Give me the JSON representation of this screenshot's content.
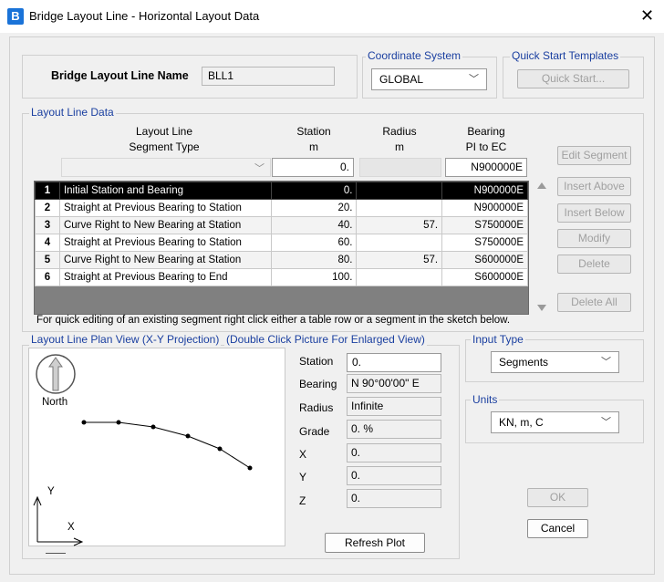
{
  "window": {
    "title": "Bridge Layout Line - Horizontal Layout Data",
    "app_icon": "B"
  },
  "name_section": {
    "label": "Bridge Layout Line Name",
    "value": "BLL1"
  },
  "coordinate_system": {
    "label": "Coordinate System",
    "value": "GLOBAL"
  },
  "quick_start": {
    "label": "Quick Start Templates",
    "button": "Quick Start..."
  },
  "layout_line_data": {
    "label": "Layout Line Data",
    "headers": {
      "segment_type": "Layout Line\nSegment Type",
      "station": "Station\nm",
      "radius": "Radius\nm",
      "bearing": "Bearing\nPI to EC"
    },
    "edit_row": {
      "segment_type": "",
      "station": "0.",
      "radius": "",
      "bearing": "N900000E"
    },
    "rows": [
      {
        "num": "1",
        "segment_type": "Initial Station and Bearing",
        "station": "0.",
        "radius": "",
        "bearing": "N900000E"
      },
      {
        "num": "2",
        "segment_type": "Straight at Previous Bearing to Station",
        "station": "20.",
        "radius": "",
        "bearing": "N900000E"
      },
      {
        "num": "3",
        "segment_type": "Curve Right to New Bearing at Station",
        "station": "40.",
        "radius": "57.",
        "bearing": "S750000E"
      },
      {
        "num": "4",
        "segment_type": "Straight at Previous Bearing to Station",
        "station": "60.",
        "radius": "",
        "bearing": "S750000E"
      },
      {
        "num": "5",
        "segment_type": "Curve Right to New Bearing at Station",
        "station": "80.",
        "radius": "57.",
        "bearing": "S600000E"
      },
      {
        "num": "6",
        "segment_type": "Straight at Previous Bearing to End",
        "station": "100.",
        "radius": "",
        "bearing": "S600000E"
      }
    ],
    "buttons": {
      "edit_segment": "Edit Segment",
      "insert_above": "Insert Above",
      "insert_below": "Insert Below",
      "modify": "Modify",
      "delete": "Delete",
      "delete_all": "Delete All"
    },
    "hint": "For quick editing of an existing segment right click either a table row or a segment in the sketch below."
  },
  "plan_view": {
    "label": "Layout Line Plan View (X-Y Projection)",
    "sublabel": "(Double Click Picture For Enlarged View)",
    "north_label": "North",
    "axis_y": "Y",
    "axis_x": "X"
  },
  "readouts": {
    "station": {
      "label": "Station",
      "value": "0."
    },
    "bearing": {
      "label": "Bearing",
      "value": "N 90°00'00\" E"
    },
    "radius": {
      "label": "Radius",
      "value": "Infinite"
    },
    "grade": {
      "label": "Grade",
      "value": "0. %"
    },
    "x": {
      "label": "X",
      "value": "0."
    },
    "y": {
      "label": "Y",
      "value": "0."
    },
    "z": {
      "label": "Z",
      "value": "0."
    }
  },
  "input_type": {
    "label": "Input Type",
    "value": "Segments"
  },
  "units": {
    "label": "Units",
    "value": "KN, m, C"
  },
  "buttons": {
    "refresh": "Refresh Plot",
    "ok": "OK",
    "cancel": "Cancel"
  },
  "colors": {
    "accent": "#1a3fa0",
    "selected_row": "#000000",
    "app_icon": "#1a73d8"
  }
}
